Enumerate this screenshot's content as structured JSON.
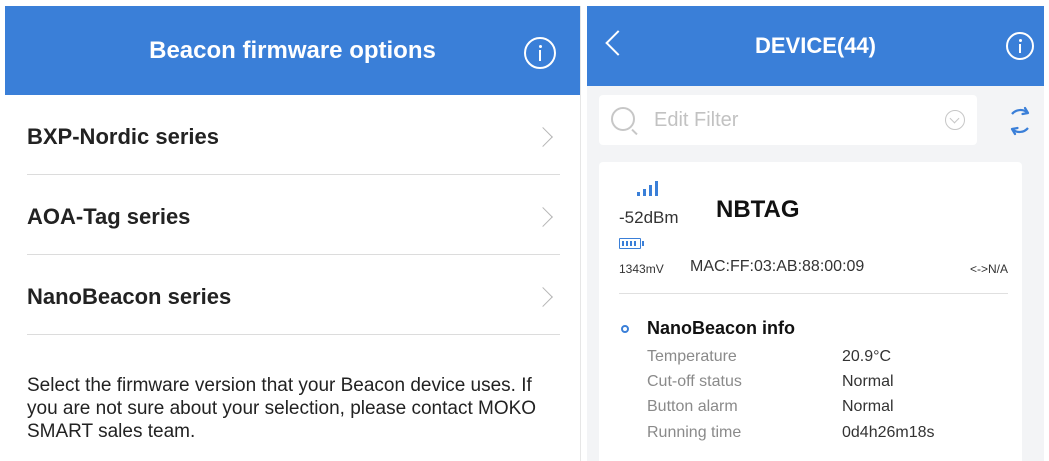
{
  "left_screen": {
    "header": {
      "title": "Beacon firmware options"
    },
    "items": [
      {
        "label": "BXP-Nordic series"
      },
      {
        "label": "AOA-Tag series"
      },
      {
        "label": "NanoBeacon series"
      }
    ],
    "description": "Select the firmware version that your Beacon device uses. If you are not sure about your selection, please contact MOKO SMART sales team."
  },
  "right_screen": {
    "header": {
      "title": "DEVICE(44)"
    },
    "filter": {
      "placeholder": "Edit Filter"
    },
    "device": {
      "rssi": "-52dBm",
      "name": "NBTAG",
      "voltage": "1343mV",
      "mac": "MAC:FF:03:AB:88:00:09",
      "connection": "<->N/A",
      "section_title": "NanoBeacon info",
      "rows": [
        {
          "label": "Temperature",
          "value": "20.9°C"
        },
        {
          "label": "Cut-off status",
          "value": "Normal"
        },
        {
          "label": "Button alarm",
          "value": "Normal"
        },
        {
          "label": "Running time",
          "value": "0d4h26m18s"
        }
      ]
    }
  },
  "colors": {
    "accent": "#3a7fd8",
    "background": "#f3f4f6"
  },
  "icons": [
    "info-icon",
    "back-icon",
    "search-icon",
    "chevron-down-icon",
    "refresh-icon",
    "signal-icon",
    "battery-icon",
    "chevron-right-icon"
  ]
}
